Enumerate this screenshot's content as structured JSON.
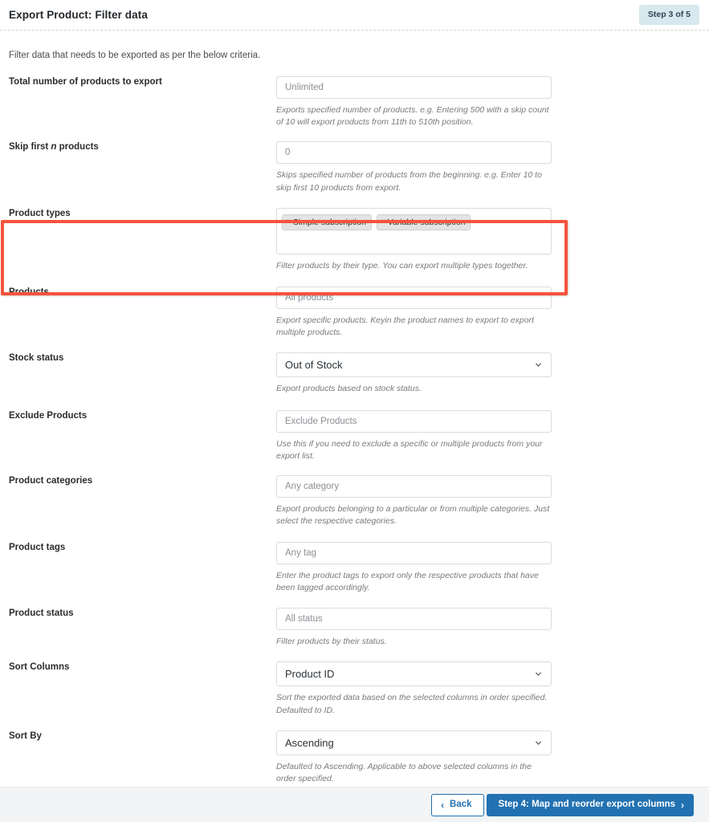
{
  "header": {
    "title": "Export Product: Filter data",
    "step_badge": "Step 3 of 5"
  },
  "intro": "Filter data that needs to be exported as per the below criteria.",
  "fields": [
    {
      "label": "Total number of products to export",
      "type": "text",
      "value": "",
      "placeholder": "Unlimited",
      "hint": "Exports specified number of products. e.g. Entering 500 with a skip count of 10 will export products from 11th to 510th position."
    },
    {
      "label": "Skip first n products",
      "label_italic_word": "n",
      "type": "text",
      "value": "",
      "placeholder": "0",
      "hint": "Skips specified number of products from the beginning. e.g. Enter 10 to skip first 10 products from export."
    },
    {
      "label": "Product types",
      "type": "tags",
      "tags": [
        "Simple subscription",
        "Variable subscription"
      ],
      "remove_glyph": "×",
      "hint": "Filter products by their type. You can export multiple types together."
    },
    {
      "label": "Products",
      "type": "text",
      "value": "",
      "placeholder": "All products",
      "hint": "Export specific products. Keyin the product names to export to export multiple products."
    },
    {
      "label": "Stock status",
      "type": "select",
      "value": "Out of Stock",
      "hint": "Export products based on stock status."
    },
    {
      "label": "Exclude Products",
      "type": "text",
      "value": "",
      "placeholder": "Exclude Products",
      "hint": "Use this if you need to exclude a specific or multiple products from your export list."
    },
    {
      "label": "Product categories",
      "type": "text",
      "value": "",
      "placeholder": "Any category",
      "hint": "Export products belonging to a particular or from multiple categories. Just select the respective categories."
    },
    {
      "label": "Product tags",
      "type": "text",
      "value": "",
      "placeholder": "Any tag",
      "hint": "Enter the product tags to export only the respective products that have been tagged accordingly."
    },
    {
      "label": "Product status",
      "type": "text",
      "value": "",
      "placeholder": "All status",
      "hint": "Filter products by their status."
    },
    {
      "label": "Sort Columns",
      "type": "select",
      "value": "Product ID",
      "hint": "Sort the exported data based on the selected columns in order specified. Defaulted to ID."
    },
    {
      "label": "Sort By",
      "type": "select",
      "value": "Ascending",
      "hint": "Defaulted to Ascending. Applicable to above selected columns in the order specified."
    }
  ],
  "footer": {
    "back_label": "Back",
    "back_arrow": "‹",
    "next_label": "Step 4: Map and reorder export columns",
    "next_arrow": "›"
  },
  "colors": {
    "accent": "#2271b1",
    "highlight": "#f4543c",
    "badge_bg": "#d8e8ef",
    "footer_bg": "#f3f4f5"
  }
}
